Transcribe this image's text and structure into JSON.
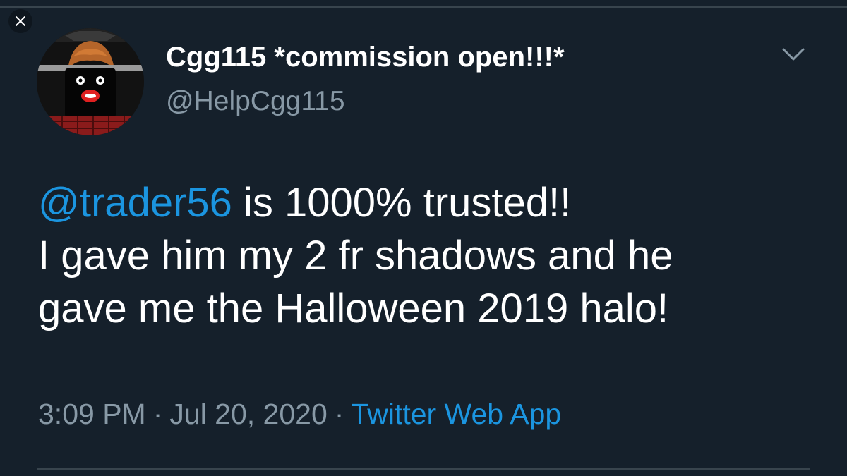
{
  "user": {
    "display_name": "Cgg115 *commission open!!!*",
    "handle": "@HelpCgg115"
  },
  "tweet": {
    "mention": "@trader56",
    "text_after_mention": " is 1000% trusted!!",
    "line2": "I gave him my 2 fr shadows and he",
    "line3": "gave me the Halloween 2019 halo!"
  },
  "meta": {
    "time": "3:09 PM",
    "separator": "·",
    "date": "Jul 20, 2020",
    "source": "Twitter Web App"
  },
  "icons": {
    "close": "close-icon",
    "chevron": "chevron-down-icon",
    "avatar": "avatar"
  },
  "colors": {
    "background": "#15202b",
    "text": "#ffffff",
    "secondary": "#8899a6",
    "accent": "#1b95e0",
    "border": "#38444d"
  }
}
